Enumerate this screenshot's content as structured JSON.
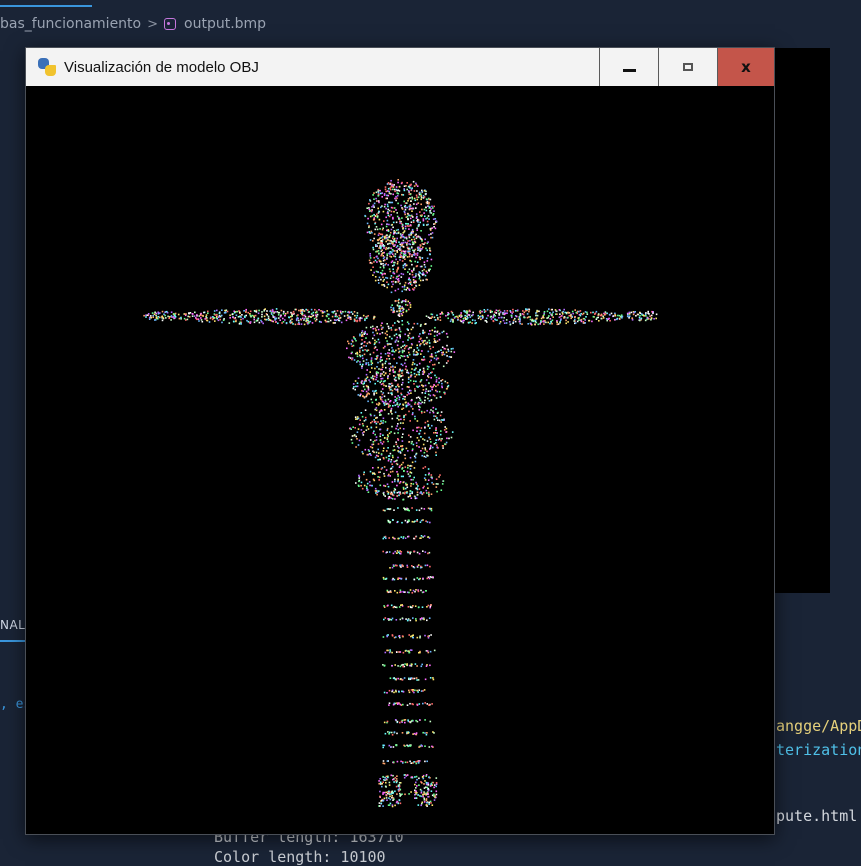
{
  "editor": {
    "breadcrumb": {
      "folder": "bas_funcionamiento",
      "separator": ">",
      "file_icon": "image-file-icon",
      "file": "output.bmp"
    },
    "panel_tab": "NAL",
    "terminal_left_fragment": ", esc",
    "terminal": {
      "path_fragment": "angge/AppD",
      "raster_fragment": "terization",
      "html_fragment": "pute.html",
      "buffer_line": "Buffer length: 163710",
      "color_line": "Color length: 10100"
    }
  },
  "window": {
    "title": "Visualización de modelo OBJ",
    "app_icon": "pygame-snake-icon",
    "controls": {
      "minimize": "minimize-icon",
      "maximize": "maximize-icon",
      "close": "x"
    },
    "viewport": {
      "description_icon": "point-cloud-render",
      "background": "#000000",
      "point_colors": [
        "#ff6b6b",
        "#6bff8f",
        "#6bb8ff",
        "#ffe66b",
        "#ff6bff",
        "#6bffff",
        "#ffffff",
        "#ffa36b",
        "#b36bff",
        "#c8ffc8"
      ]
    }
  }
}
